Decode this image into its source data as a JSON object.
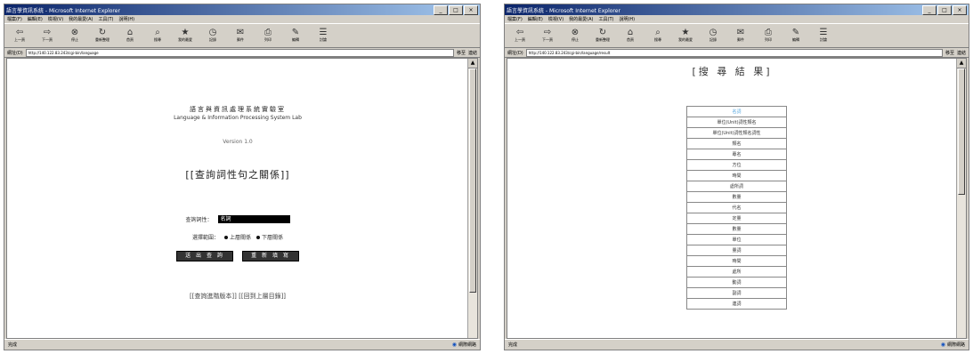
{
  "left_window": {
    "title": "語言學資訊系統 - Microsoft Internet Explorer",
    "menu": [
      "檔案(F)",
      "編輯(E)",
      "檢視(V)",
      "我的最愛(A)",
      "工具(T)",
      "說明(H)"
    ],
    "toolbar": [
      {
        "icon": "back-icon",
        "label": "上一頁"
      },
      {
        "icon": "forward-icon",
        "label": "下一頁"
      },
      {
        "icon": "stop-icon",
        "label": "停止"
      },
      {
        "icon": "refresh-icon",
        "label": "重新整理"
      },
      {
        "icon": "home-icon",
        "label": "首頁"
      },
      {
        "icon": "search-icon",
        "label": "搜尋"
      },
      {
        "icon": "favorites-icon",
        "label": "我的最愛"
      },
      {
        "icon": "history-icon",
        "label": "記錄"
      },
      {
        "icon": "mail-icon",
        "label": "郵件"
      },
      {
        "icon": "print-icon",
        "label": "列印"
      },
      {
        "icon": "edit-icon",
        "label": "編輯"
      },
      {
        "icon": "discuss-icon",
        "label": "討論"
      }
    ],
    "address_label": "網址(D)",
    "address": "http://140.122.83.243/cgi-bin/language",
    "go_label": "移至",
    "links_label": "連結",
    "status_text": "完成",
    "zone_text": "網際網路",
    "lab_name_zh": "語言與資訊處理系統實驗室",
    "lab_name_en": "Language & Information Processing System Lab",
    "version": "Version 1.0",
    "main_title": "[[查詢詞性句之關係]]",
    "input_label": "查詢詞性：",
    "input_value": "名詞",
    "radio_label": "選擇範圍：",
    "radio_options": [
      "上層關係",
      "下層關係"
    ],
    "buttons": [
      "送 出 查 詢",
      "重 新 填 寫"
    ],
    "footer_links": "[[查詢進階版本]]  [[回到上層目錄]]"
  },
  "right_window": {
    "title": "語言學資訊系統 - Microsoft Internet Explorer",
    "menu": [
      "檔案(F)",
      "編輯(E)",
      "檢視(V)",
      "我的最愛(A)",
      "工具(T)",
      "說明(H)"
    ],
    "address_label": "網址(D)",
    "address": "http://140.122.83.243/cgi-bin/language/result",
    "go_label": "移至",
    "links_label": "連結",
    "status_text": "完成",
    "zone_text": "網際網路",
    "result_title": "[搜 尋 結 果]",
    "result_items": [
      "名詞",
      "單位(Unit)詞性類名",
      "單位(Unit)詞性類名詞性",
      "類名",
      "專名",
      "方位",
      "時間",
      "處所詞",
      "數量",
      "代名",
      "定量",
      "數量",
      "單位",
      "量詞",
      "時間",
      "處所",
      "動詞",
      "副詞",
      "連詞"
    ]
  }
}
